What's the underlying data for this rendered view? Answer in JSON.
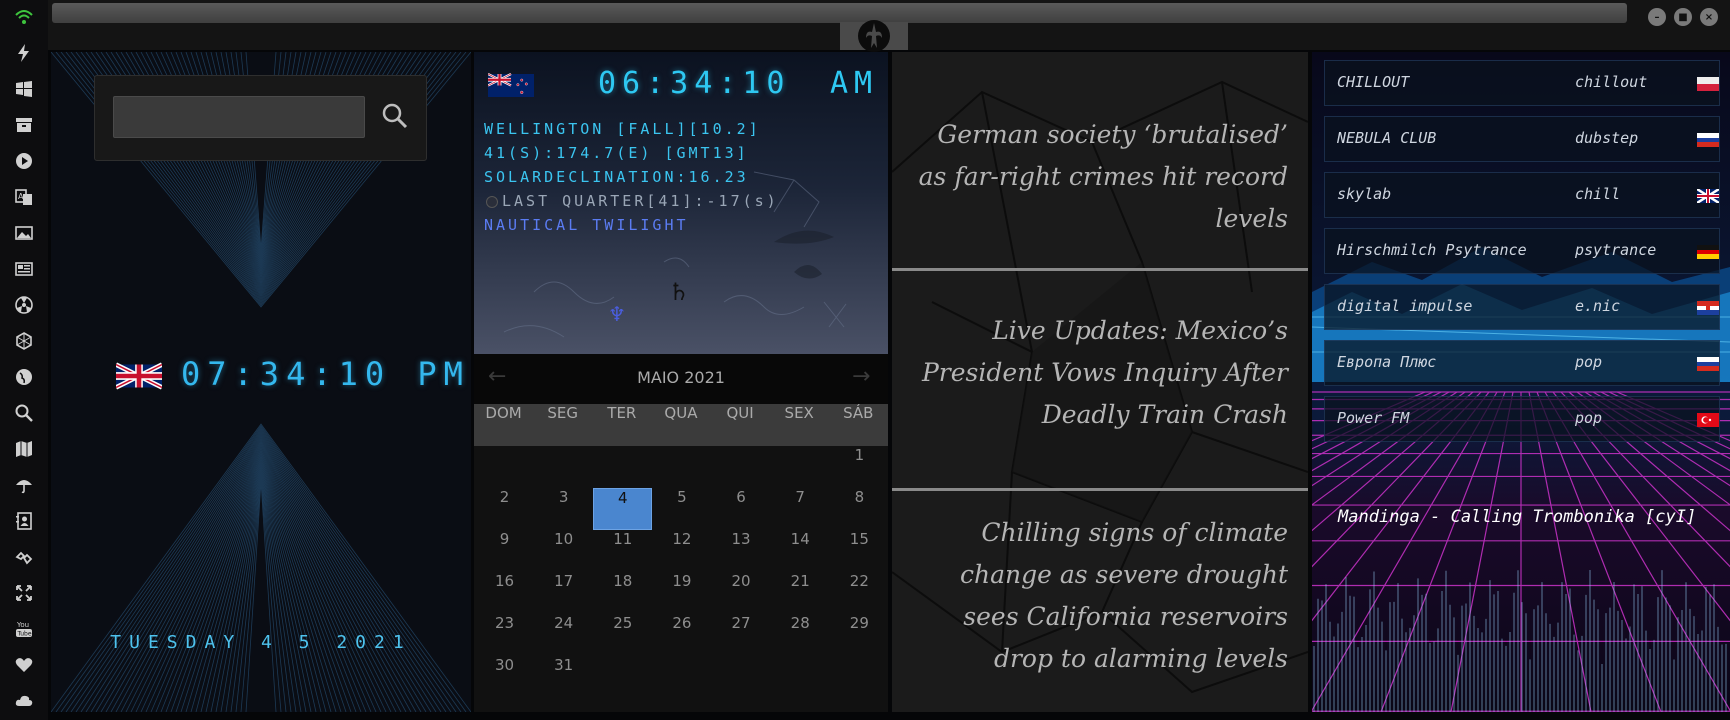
{
  "window": {
    "top_icon": "rebel-alliance-icon",
    "controls": [
      "minimize",
      "maximize",
      "close"
    ]
  },
  "rail_icons": [
    "wifi-icon",
    "lightning-icon",
    "windows-icon",
    "archive-icon",
    "play-icon",
    "translate-icon",
    "image-icon",
    "news-icon",
    "radiation-icon",
    "hexagon-icon",
    "globe-icon",
    "search-icon",
    "map-icon",
    "umbrella-icon",
    "contacts-icon",
    "link-icon",
    "expand-icon",
    "youtube-icon",
    "heart-icon",
    "cloud-icon"
  ],
  "clock": {
    "search_placeholder": "",
    "time": "07:34:10 PM",
    "date": "TUESDAY 4 5 2021"
  },
  "nz": {
    "time": "06:34:10",
    "ampm": "AM",
    "line1": "WELLINGTON [FALL][10.2]",
    "line2": "41(S):174.7(E) [GMT13]",
    "line3": "SOLARDECLINATION:16.23",
    "line4": "LAST QUARTER[41]:-17(s)",
    "line5": "NAUTICAL TWILIGHT",
    "saturn": "♄",
    "neptune": "♆"
  },
  "calendar": {
    "month": "MAIO 2021",
    "prev": "←",
    "next": "→",
    "weekdays": [
      "DOM",
      "SEG",
      "TER",
      "QUA",
      "QUI",
      "SEX",
      "SÁB"
    ],
    "first_weekday_index": 6,
    "days_in_month": 31,
    "today": 4
  },
  "news": [
    "German society ‘brutalised’ as far-right crimes hit record levels",
    "Live Updates: Mexico’s President Vows Inquiry After Deadly Train Crash",
    "Chilling signs of climate change as severe drought sees California reservoirs drop to alarming levels"
  ],
  "radio": {
    "stations": [
      {
        "name": "CHILLOUT",
        "genre": "chillout",
        "flag": "poland"
      },
      {
        "name": "NEBULA CLUB",
        "genre": "dubstep",
        "flag": "russia"
      },
      {
        "name": "skylab",
        "genre": "chill",
        "flag": "uk"
      },
      {
        "name": "Hirschmilch Psytrance",
        "genre": "psytrance",
        "flag": "germany"
      },
      {
        "name": "digital impulse",
        "genre": "e.nic",
        "flag": "croatia"
      },
      {
        "name": "Европа Плюс",
        "genre": "pop",
        "flag": "russia"
      },
      {
        "name": "Power FM",
        "genre": "pop",
        "flag": "turkey"
      }
    ],
    "now_playing": "Mandinga - Calling Trombonika [cyI]"
  },
  "colors": {
    "digital_cyan": "#34b8ee",
    "today_highlight": "#4a86cf",
    "twilight": "#5b7cf2"
  }
}
